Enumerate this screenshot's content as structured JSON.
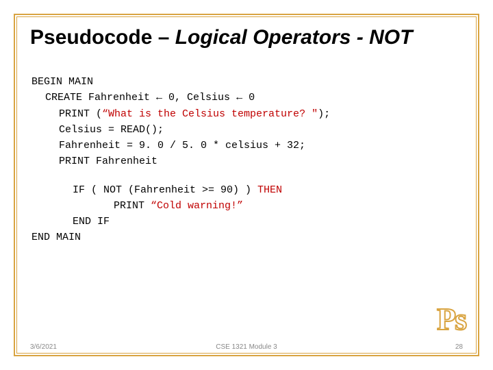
{
  "title": {
    "part1": "Pseudocode – ",
    "part2": "Logical Operators - NOT"
  },
  "code": {
    "l1": "BEGIN MAIN",
    "l2_pre": "CREATE Fahrenheit ",
    "l2_arrow1": "←",
    "l2_mid": " 0, Celsius ",
    "l2_arrow2": "←",
    "l2_post": " 0",
    "l3_pre": "PRINT (",
    "l3_str": "“What is the Celsius temperature? \"",
    "l3_post": ");",
    "l4": "Celsius = READ();",
    "l5": "Fahrenheit = 9. 0 / 5. 0 * celsius + 32;",
    "l6": "PRINT Fahrenheit",
    "l7_pre": "IF ( NOT (Fahrenheit >= 90) ) ",
    "l7_then": "THEN",
    "l8_pre": "PRINT ",
    "l8_str": "“Cold warning!”",
    "l9": "END IF",
    "l10": "END MAIN"
  },
  "logo": "Ps",
  "footer": {
    "left": "3/6/2021",
    "center": "CSE 1321 Module 3",
    "right": "28"
  }
}
